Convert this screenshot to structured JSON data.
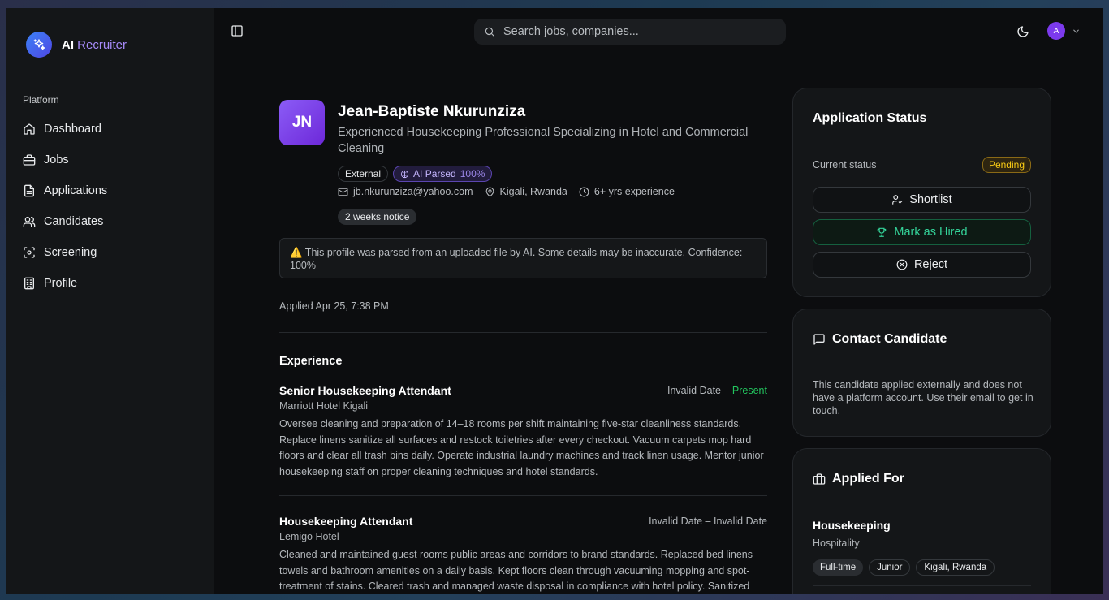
{
  "app": {
    "brand_primary": "AI",
    "brand_secondary": "Recruiter"
  },
  "sidebar": {
    "section_label": "Platform",
    "items": [
      {
        "label": "Dashboard",
        "icon": "home-icon"
      },
      {
        "label": "Jobs",
        "icon": "briefcase-icon"
      },
      {
        "label": "Applications",
        "icon": "file-icon"
      },
      {
        "label": "Candidates",
        "icon": "users-icon"
      },
      {
        "label": "Screening",
        "icon": "scan-icon"
      },
      {
        "label": "Profile",
        "icon": "building-icon"
      }
    ]
  },
  "topbar": {
    "search_placeholder": "Search jobs, companies...",
    "avatar_initial": "A"
  },
  "candidate": {
    "initials": "JN",
    "name": "Jean-Baptiste Nkurunziza",
    "headline": "Experienced Housekeeping Professional Specializing in Hotel and Commercial Cleaning",
    "badge_source": "External",
    "badge_ai": "AI Parsed",
    "badge_ai_confidence": "100%",
    "email": "jb.nkurunziza@yahoo.com",
    "location": "Kigali, Rwanda",
    "experience": "6+ yrs experience",
    "notice": "2 weeks notice",
    "warning": "⚠️ This profile was parsed from an uploaded file by AI. Some details may be inaccurate. Confidence: 100%",
    "applied": "Applied Apr 25, 7:38 PM"
  },
  "experience": {
    "title": "Experience",
    "jobs": [
      {
        "title": "Senior Housekeeping Attendant",
        "company": "Marriott Hotel Kigali",
        "start": "Invalid Date",
        "sep": " – ",
        "end": "Present",
        "description": "Oversee cleaning and preparation of 14–18 rooms per shift maintaining five-star cleanliness standards. Replace linens sanitize all surfaces and restock toiletries after every checkout. Vacuum carpets mop hard floors and clear all trash bins daily. Operate industrial laundry machines and track linen usage. Mentor junior housekeeping staff on proper cleaning techniques and hotel standards."
      },
      {
        "title": "Housekeeping Attendant",
        "company": "Lemigo Hotel",
        "start": "Invalid Date",
        "sep": " – ",
        "end": "Invalid Date",
        "description": "Cleaned and maintained guest rooms public areas and corridors to brand standards. Replaced bed linens towels and bathroom amenities on a daily basis. Kept floors clean through vacuuming mopping and spot-treatment of stains. Cleared trash and managed waste disposal in compliance with hotel policy. Sanitized surfaces and high-contact points to prevent cross-contamination."
      }
    ]
  },
  "status_card": {
    "title": "Application Status",
    "current_label": "Current status",
    "current_value": "Pending",
    "shortlist": "Shortlist",
    "hire": "Mark as Hired",
    "reject": "Reject"
  },
  "contact_card": {
    "title": "Contact Candidate",
    "text": "This candidate applied externally and does not have a platform account. Use their email to get in touch."
  },
  "applied_card": {
    "title": "Applied For",
    "job": "Housekeeping",
    "category": "Hospitality",
    "tags": [
      "Full-time",
      "Junior",
      "Kigali, Rwanda"
    ]
  },
  "colors": {
    "accent": "#7c3aed",
    "present": "#22c55e",
    "pending": "#facc15",
    "hire": "#34d399"
  }
}
